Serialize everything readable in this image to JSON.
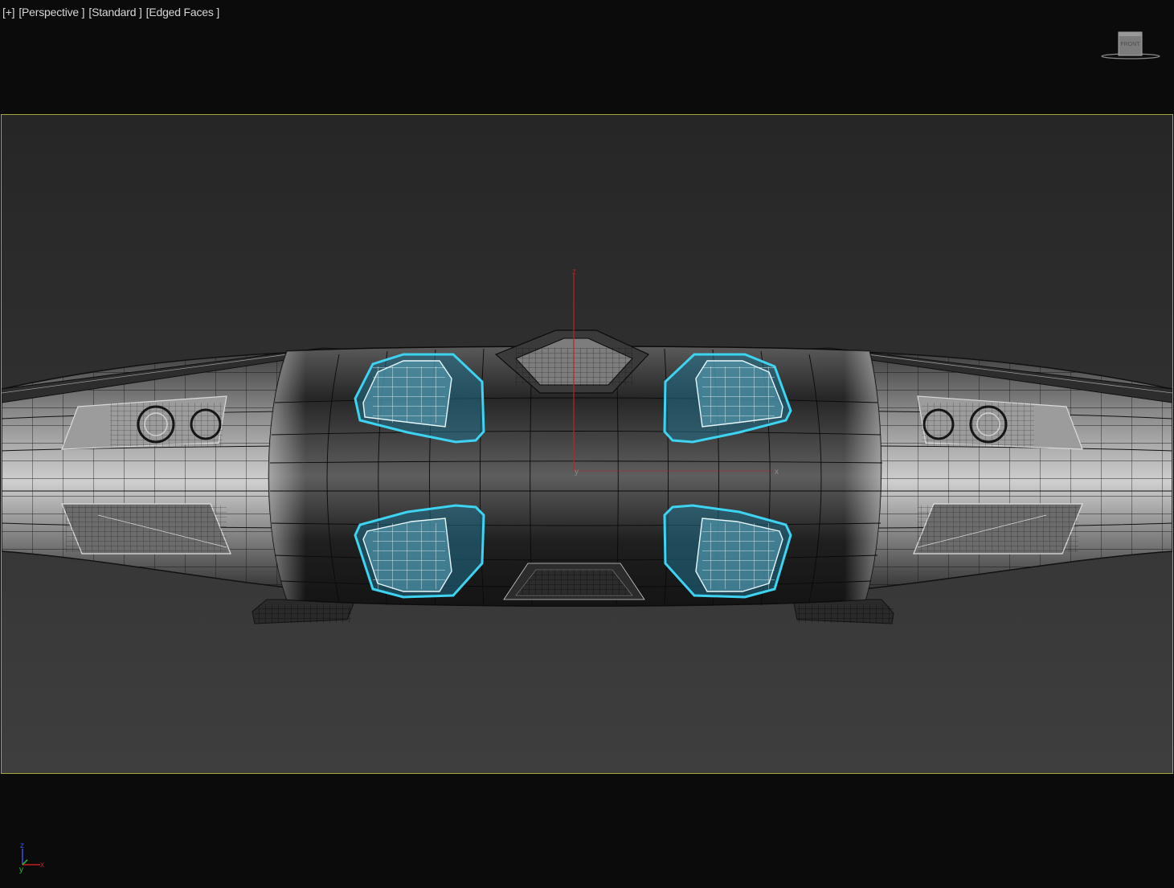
{
  "viewport": {
    "labels": [
      "[+]",
      "[Perspective ]",
      "[Standard ]",
      "[Edged Faces ]"
    ]
  },
  "viewcube": {
    "face": "FRONT",
    "icon": "viewcube-icon"
  },
  "gizmo": {
    "axes": [
      "z",
      "y",
      "x"
    ]
  },
  "axis_tripod": {
    "axes": [
      "z",
      "y",
      "x"
    ],
    "icon": "axis-tripod-icon"
  },
  "colors": {
    "background": "#0b0b0b",
    "safe_frame_border": "#a5a53a",
    "selection": "#3ed3f0",
    "selection_fill": "#1f6f8a",
    "axis_z": "#c42020",
    "axis_x": "#c42020",
    "axis_y": "#2fbf2f",
    "wire": "#111111",
    "wire_light": "#dcdcdc"
  }
}
